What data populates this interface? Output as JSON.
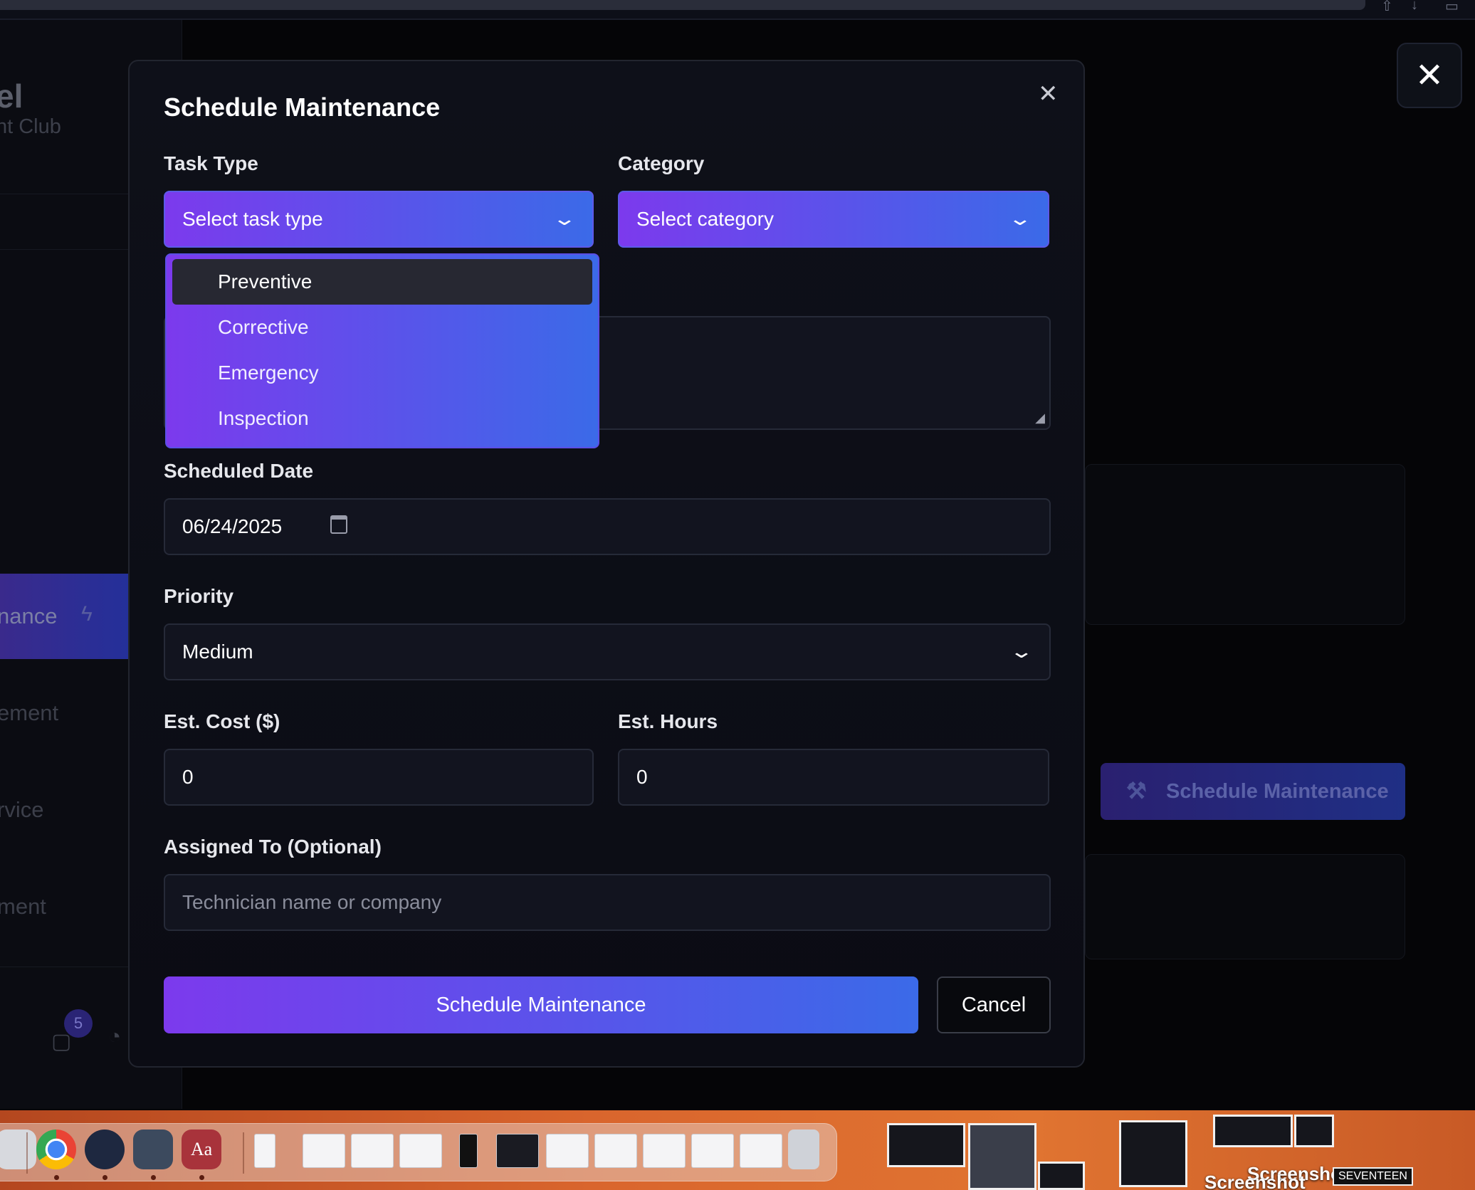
{
  "background": {
    "brand_title": "el",
    "brand_subtitle": "ht Club",
    "sidebar_active": "nance",
    "sidebar_items": [
      "ement",
      "rvice",
      "ment"
    ],
    "badge_count": "5",
    "bg_button_label": "Schedule Maintenance",
    "close_label": "✕"
  },
  "modal": {
    "title": "Schedule Maintenance",
    "close_icon": "close-icon",
    "task_type": {
      "label": "Task Type",
      "placeholder": "Select task type"
    },
    "category": {
      "label": "Category",
      "placeholder": "Select category"
    },
    "task_type_options": [
      "Preventive",
      "Corrective",
      "Emergency",
      "Inspection"
    ],
    "highlighted_option": "Preventive",
    "scheduled_date": {
      "label": "Scheduled Date",
      "value": "06/24/2025"
    },
    "priority": {
      "label": "Priority",
      "value": "Medium"
    },
    "est_cost": {
      "label": "Est. Cost ($)",
      "value": "0"
    },
    "est_hours": {
      "label": "Est. Hours",
      "value": "0"
    },
    "assigned_to": {
      "label": "Assigned To (Optional)",
      "placeholder": "Technician name or company"
    },
    "submit_label": "Schedule Maintenance",
    "cancel_label": "Cancel"
  },
  "dock": {
    "dictionary_label": "Aa",
    "desktop_labels": [
      "Screenshot",
      "Screenshot"
    ],
    "desktop_tag": "SEVENTEEN"
  },
  "colors": {
    "accent_start": "#7c3aed",
    "accent_end": "#3b6ae8",
    "modal_bg": "#0e1019",
    "field_bg": "#12141f"
  }
}
